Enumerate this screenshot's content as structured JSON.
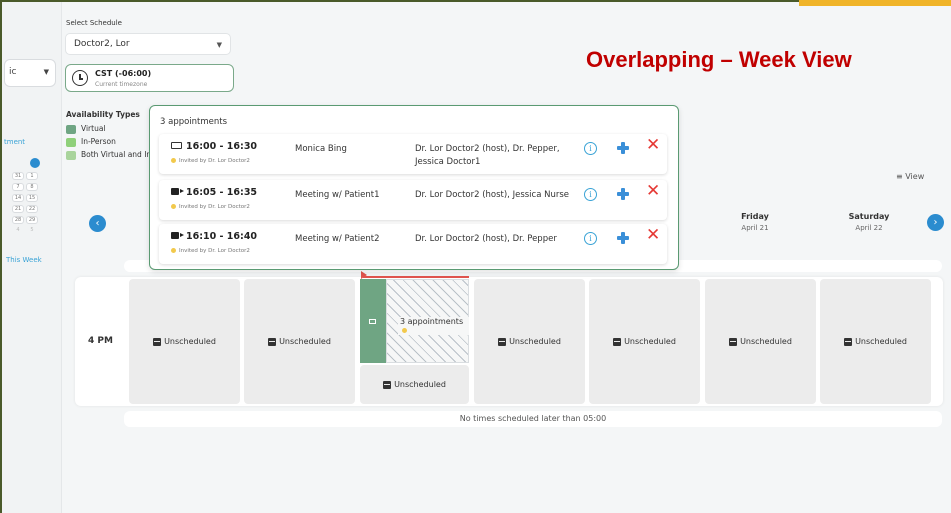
{
  "slide_title": "Overlapping – Week View",
  "select_schedule": {
    "label": "Select Schedule",
    "value": "Doctor2, Lor"
  },
  "timezone": {
    "main": "CST (-06:00)",
    "sub": "Current timezone"
  },
  "left_nav": {
    "tz_fragment": "ic",
    "appointment_fragment": "tment",
    "this_week_fragment": "This Week",
    "mini_calendar": [
      "31",
      "1",
      "7",
      "8",
      "14",
      "15",
      "21",
      "22",
      "28",
      "29",
      "4",
      "5"
    ]
  },
  "availability": {
    "title": "Availability Types",
    "items": [
      {
        "label": "Virtual",
        "color": "#6fa583"
      },
      {
        "label": "In-Person",
        "color": "#8fd07a"
      },
      {
        "label": "Both Virtual and In",
        "color": "#a9d49c"
      }
    ]
  },
  "view_control": "≡ View",
  "days": [
    {
      "name": "Friday",
      "date": "April 21"
    },
    {
      "name": "Saturday",
      "date": "April 22"
    }
  ],
  "popup": {
    "title": "3 appointments",
    "appointments": [
      {
        "time": "16:00 - 16:30",
        "invited": "Invited by Dr. Lor Doctor2",
        "title": "Monica Bing",
        "host": "Dr. Lor Doctor2 (host), Dr. Pepper, Jessica Doctor1",
        "icon": "laptop-icon"
      },
      {
        "time": "16:05 - 16:35",
        "invited": "Invited by Dr. Lor Doctor2",
        "title": "Meeting w/ Patient1",
        "host": "Dr. Lor Doctor2 (host), Jessica Nurse",
        "icon": "video-icon"
      },
      {
        "time": "16:10 - 16:40",
        "invited": "Invited by Dr. Lor Doctor2",
        "title": "Meeting w/ Patient2",
        "host": "Dr. Lor Doctor2 (host), Dr. Pepper",
        "icon": "video-icon"
      }
    ],
    "info_glyph": "i",
    "close_glyph": "✕"
  },
  "grid": {
    "time_label": "4 PM",
    "unscheduled": "Unscheduled",
    "overlap_label": "3 appointments",
    "footer": "No times scheduled later than 05:00"
  },
  "colors": {
    "accent": "#2b8ccf",
    "title_red": "#c00000",
    "virtual_green": "#6fa583",
    "close_red": "#e53935"
  }
}
